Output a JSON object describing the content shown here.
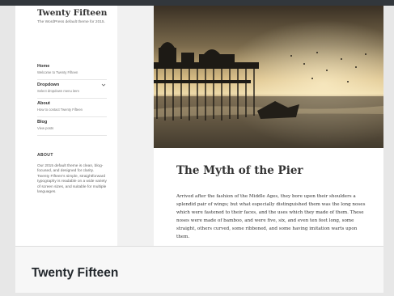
{
  "site": {
    "title": "Twenty Fifteen",
    "description": "The WordPress default theme for 2015."
  },
  "menu": [
    {
      "label": "Home",
      "sub": "Welcome to Twenty Fifteen",
      "has_children": false
    },
    {
      "label": "Dropdown",
      "sub": "Select dropdown menu item",
      "has_children": true
    },
    {
      "label": "About",
      "sub": "How to contact Twenty Fifteen",
      "has_children": false
    },
    {
      "label": "Blog",
      "sub": "View posts",
      "has_children": false
    }
  ],
  "widget": {
    "title": "ABOUT",
    "text": "Our 2015 default theme is clean, blog-focused, and designed for clarity. Twenty Fifteen's simple, straightforward typography is readable on a wide variety of screen sizes, and suitable for multiple languages."
  },
  "post": {
    "title": "The Myth of the Pier",
    "body": "Arrived after the fashion of the Middle Ages, they bore upon their shoulders a splendid pair of wings; but what especially distinguished them was the long noses which were fastened to their faces, and the uses which they made of them. These noses were made of bamboo, and were five, six, and even ten feet long, some straight, others curved, some ribboned, and some having imitation warts upon them."
  },
  "theme_bar": {
    "name": "Twenty Fifteen"
  },
  "colors": {
    "admin_bar": "#32373c",
    "sidebar_bg": "#ffffff",
    "page_bg": "#e7e7e7"
  }
}
